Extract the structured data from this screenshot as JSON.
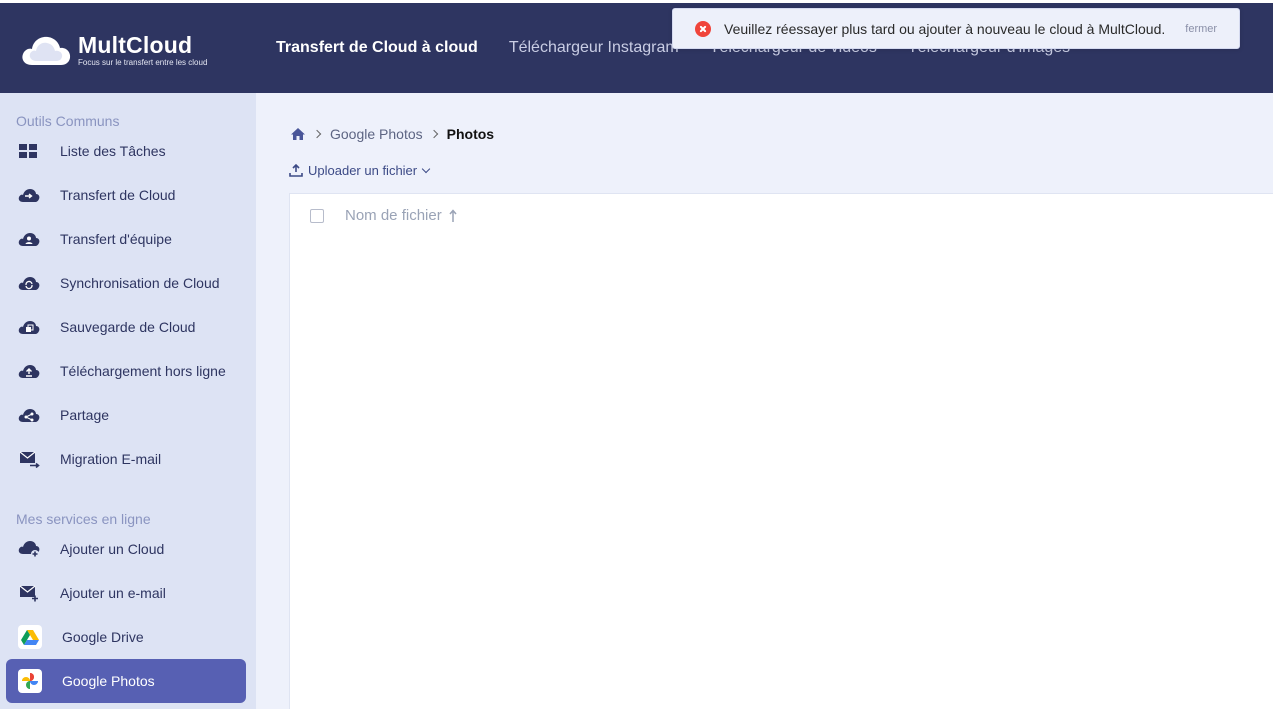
{
  "brand": {
    "title": "MultCloud",
    "subtitle": "Focus sur le transfert entre les cloud"
  },
  "nav": {
    "tabs": [
      {
        "label": "Transfert de Cloud à cloud",
        "active": true
      },
      {
        "label": "Téléchargeur Instagram",
        "active": false
      },
      {
        "label": "Téléchargeur de vidéos",
        "active": false
      },
      {
        "label": "Téléchargeur d'images",
        "active": false
      }
    ]
  },
  "toast": {
    "message": "Veuillez réessayer plus tard ou ajouter à nouveau le cloud à MultCloud.",
    "close_label": "fermer",
    "icon": "error-icon"
  },
  "sidebar": {
    "common_title": "Outils Communs",
    "common_items": [
      {
        "label": "Liste des Tâches",
        "icon": "task-list-icon"
      },
      {
        "label": "Transfert de Cloud",
        "icon": "cloud-transfer-icon"
      },
      {
        "label": "Transfert d'équipe",
        "icon": "team-transfer-icon"
      },
      {
        "label": "Synchronisation de Cloud",
        "icon": "cloud-sync-icon"
      },
      {
        "label": "Sauvegarde de Cloud",
        "icon": "cloud-backup-icon"
      },
      {
        "label": "Téléchargement hors ligne",
        "icon": "offline-download-icon"
      },
      {
        "label": "Partage",
        "icon": "share-icon"
      },
      {
        "label": "Migration E-mail",
        "icon": "email-migration-icon"
      }
    ],
    "services_title": "Mes services en ligne",
    "service_items": [
      {
        "label": "Ajouter un Cloud",
        "icon": "add-cloud-icon"
      },
      {
        "label": "Ajouter un e-mail",
        "icon": "add-email-icon"
      },
      {
        "label": "Google Drive",
        "icon": "google-drive-icon"
      },
      {
        "label": "Google Photos",
        "icon": "google-photos-icon",
        "active": true
      }
    ]
  },
  "breadcrumb": {
    "items": [
      "Google Photos",
      "Photos"
    ]
  },
  "toolbar": {
    "upload_label": "Uploader un fichier"
  },
  "file_table": {
    "column_name": "Nom de fichier"
  },
  "colors": {
    "header_bg": "#2e3561",
    "sidebar_bg": "#dde3f4",
    "active_item_bg": "#5760b3",
    "main_bg": "#eef1fb",
    "error_red": "#f0443a"
  }
}
